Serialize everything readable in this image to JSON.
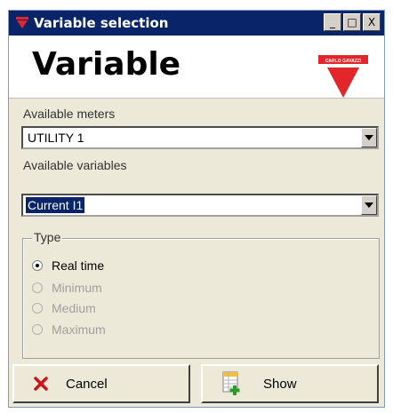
{
  "window": {
    "title": "Variable selection",
    "buttons": {
      "minimize": "_",
      "maximize": "□",
      "close": "X"
    }
  },
  "header": {
    "title": "Variable",
    "logo_text": "CARLO GAVAZZI"
  },
  "meters": {
    "label": "Available meters",
    "value": "UTILITY 1"
  },
  "variables": {
    "label": "Available variables",
    "value": "Current I1"
  },
  "type_group": {
    "legend": "Type",
    "options": [
      {
        "label": "Real time",
        "selected": true,
        "enabled": true
      },
      {
        "label": "Minimum",
        "selected": false,
        "enabled": false
      },
      {
        "label": "Medium",
        "selected": false,
        "enabled": false
      },
      {
        "label": "Maximum",
        "selected": false,
        "enabled": false
      }
    ]
  },
  "buttons": {
    "cancel": "Cancel",
    "show": "Show"
  },
  "colors": {
    "title_bar": "#0a246a",
    "brand_red": "#e3262b",
    "dialog_bg": "#ece9d8"
  },
  "icons": [
    "carlo-gavazzi-logo-icon",
    "dropdown-arrow-icon",
    "cancel-x-icon",
    "show-table-icon"
  ]
}
